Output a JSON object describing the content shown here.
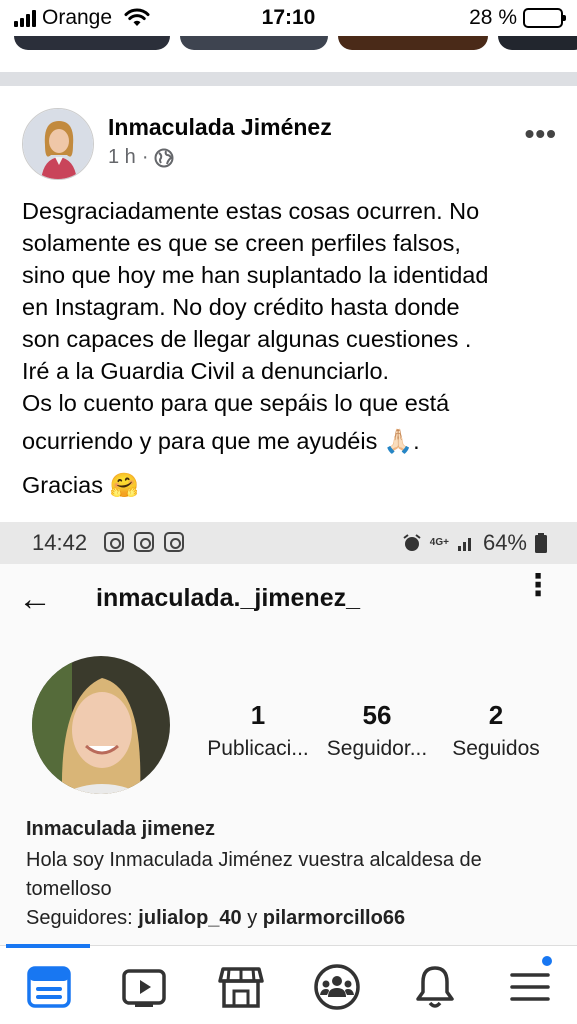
{
  "status_bar": {
    "carrier": "Orange",
    "time": "17:10",
    "battery": "28 %",
    "battery_level": 0.28
  },
  "post": {
    "author": "Inmaculada Jiménez",
    "time_ago": "1 h",
    "separator": "·",
    "audience_icon": "globe-icon",
    "more_icon": "more-horizontal-icon",
    "lines": [
      "Desgraciadamente estas cosas ocurren. No",
      "solamente es que se creen perfiles falsos,",
      "sino que hoy me han suplantado la identidad",
      "en Instagram. No doy crédito hasta donde",
      "son capaces de llegar algunas cuestiones .",
      "Iré a la Guardia Civil a denunciarlo.",
      "Os lo cuento para que sepáis lo que está",
      "ocurriendo y para que me ayudéis 🙏🏻.",
      "Gracias 🤗"
    ]
  },
  "embedded_screenshot": {
    "status": {
      "time": "14:42",
      "battery": "64%",
      "network": "4G+"
    },
    "username": "inmaculada._jimenez_",
    "stats": [
      {
        "value": "1",
        "label": "Publicaci..."
      },
      {
        "value": "56",
        "label": "Seguidor..."
      },
      {
        "value": "2",
        "label": "Seguidos"
      }
    ],
    "display_name": "Inmaculada jimenez",
    "bio_lines": [
      "Hola soy Inmaculada Jiménez vuestra alcaldesa de",
      "tomelloso"
    ],
    "followed_by": {
      "prefix": "Seguidores: ",
      "user1": "julialop_40",
      "connector": " y ",
      "user2": "pilarmorcillo66"
    }
  },
  "bottom_nav": {
    "items": [
      "feed-icon",
      "video-icon",
      "marketplace-icon",
      "groups-icon",
      "notifications-icon",
      "menu-icon"
    ],
    "accent_color": "#1877f2"
  }
}
